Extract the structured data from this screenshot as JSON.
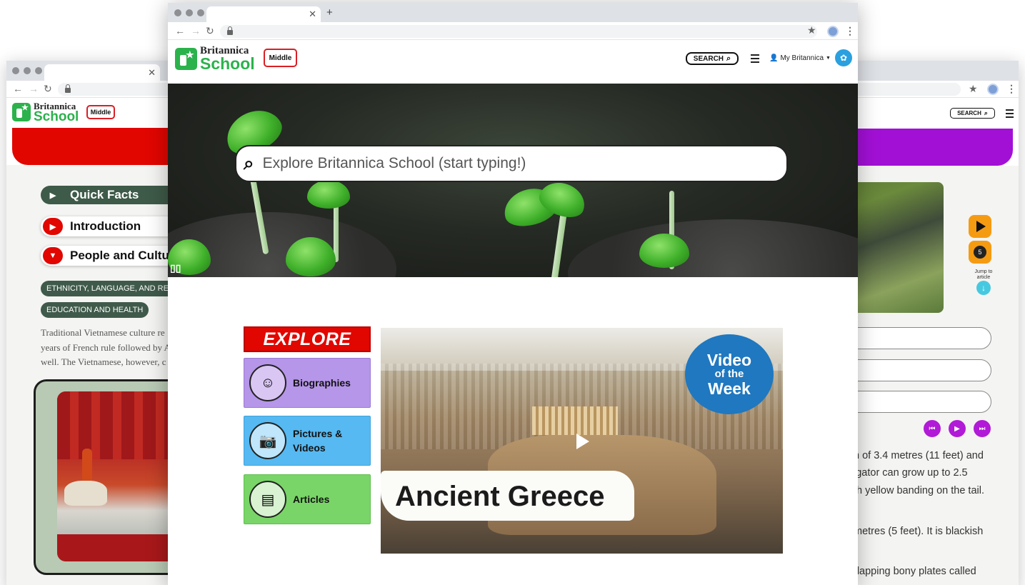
{
  "brand": {
    "top": "Britannica",
    "bottom": "School",
    "level": "Middle",
    "colors": {
      "green": "#2bb24c",
      "red": "#e10600",
      "purple": "#a210d6",
      "orange": "#f59b12"
    }
  },
  "left_window": {
    "sections": [
      {
        "label": "Quick Facts",
        "icon": "play-right-icon"
      },
      {
        "label": "Introduction",
        "icon": "play-right-icon"
      },
      {
        "label": "People and Cultu",
        "icon": "caret-down-icon"
      }
    ],
    "tags": [
      "ETHNICITY, LANGUAGE, AND RELIG",
      "EDUCATION AND HEALTH"
    ],
    "paragraph_lines": [
      "Traditional Vietnamese culture re",
      "years of French rule followed by A",
      "well. The Vietnamese, however, c"
    ],
    "search_label": "SEARCH"
  },
  "right_window": {
    "search_label": "SEARCH",
    "side_controls": {
      "count": "5",
      "jump_line1": "Jump to",
      "jump_line2": "article"
    },
    "paragraph_lines": [
      "h of 3.4 metres (11 feet) and",
      "igator can grow up to 2.5",
      "th yellow banding on the tail.",
      "metres (5 feet). It is blackish",
      "rlapping bony plates called"
    ]
  },
  "main_window": {
    "header": {
      "search_label": "SEARCH",
      "account_label": "My Britannica"
    },
    "hero": {
      "search_placeholder": "Explore Britannica School (start typing!)"
    },
    "explore": {
      "heading": "EXPLORE",
      "cards": [
        {
          "label": "Biographies",
          "color": "#b596e8",
          "icon": "portrait-icon"
        },
        {
          "label": "Pictures &",
          "label2": "Videos",
          "color": "#56b9f1",
          "icon": "camera-film-icon"
        },
        {
          "label": "Articles",
          "color": "#79d567",
          "icon": "article-icon"
        }
      ]
    },
    "video": {
      "title": "Ancient Greece",
      "badge_line1": "Video",
      "badge_line2": "of the",
      "badge_line3": "Week"
    }
  }
}
